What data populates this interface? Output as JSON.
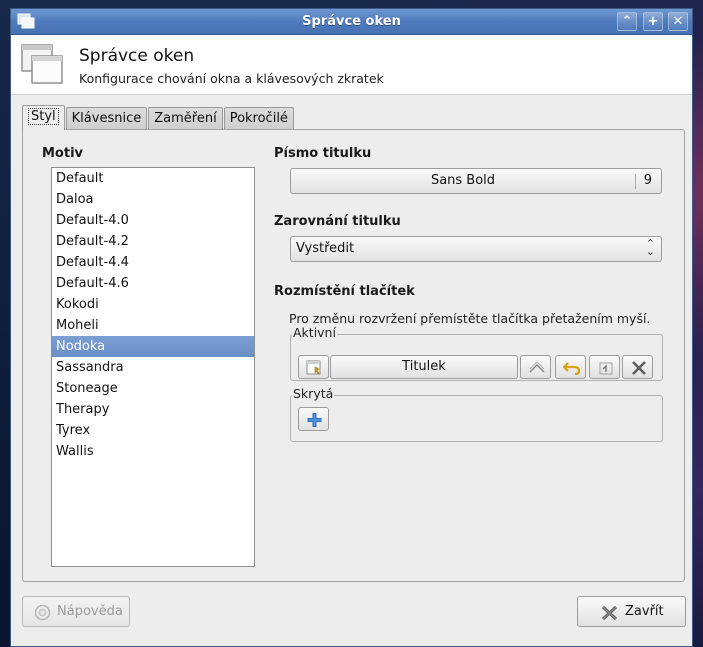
{
  "window": {
    "title": "Správce oken"
  },
  "header": {
    "title": "Správce oken",
    "subtitle": "Konfigurace chování okna a klávesových zkratek"
  },
  "tabs": [
    {
      "label": "Styl"
    },
    {
      "label": "Klávesnice"
    },
    {
      "label": "Zaměření"
    },
    {
      "label": "Pokročilé"
    }
  ],
  "theme": {
    "label": "Motiv",
    "items": [
      "Default",
      "Daloa",
      "Default-4.0",
      "Default-4.2",
      "Default-4.4",
      "Default-4.6",
      "Kokodi",
      "Moheli",
      "Nodoka",
      "Sassandra",
      "Stoneage",
      "Therapy",
      "Tyrex",
      "Wallis"
    ],
    "selected": "Nodoka"
  },
  "title_font": {
    "label": "Písmo titulku",
    "font": "Sans Bold",
    "size": "9"
  },
  "title_alignment": {
    "label": "Zarovnání titulku",
    "value": "Vystředit"
  },
  "button_layout": {
    "label": "Rozmístění tlačítek",
    "hint": "Pro změnu rozvržení přemístěte tlačítka přetažením myší.",
    "active_label": "Aktivní",
    "title_button": "Titulek",
    "hidden_label": "Skrytá"
  },
  "footer": {
    "help_label": "Nápověda",
    "close_label": "Zavřít"
  },
  "colors": {
    "titlebar": "#4f7bbd",
    "selection": "#6a8fc7"
  }
}
